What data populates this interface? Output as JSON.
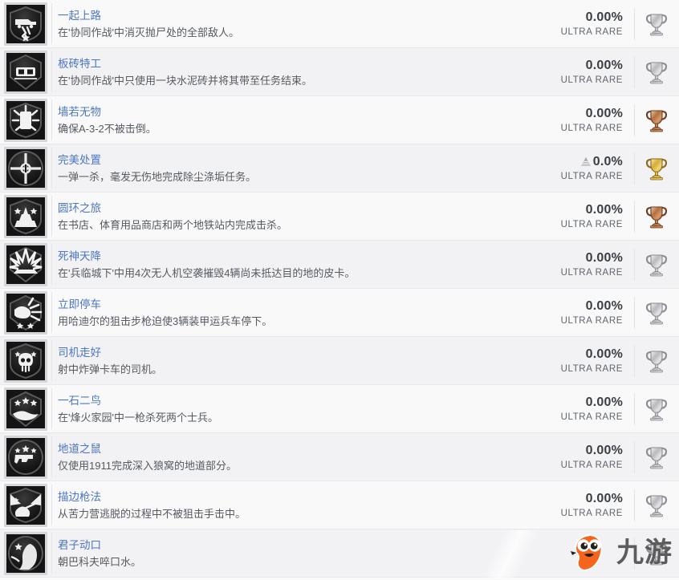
{
  "list": {
    "rarity_label_default": "ULTRA RARE",
    "rows": [
      {
        "title": "一起上路",
        "desc": "在'协同作战'中消灭抛尸处的全部敌人。",
        "percent": "0.00%",
        "rarity": "ULTRA RARE",
        "trophy": "silver-trophy-icon",
        "icon": "badge-truck-icon",
        "has_pyramid": false
      },
      {
        "title": "板砖特工",
        "desc": "在'协同作战'中只使用一块水泥砖并将其带至任务结束。",
        "percent": "0.00%",
        "rarity": "ULTRA RARE",
        "trophy": "silver-trophy-icon",
        "icon": "badge-brick-icon",
        "has_pyramid": false
      },
      {
        "title": "墙若无物",
        "desc": "确保A-3-2不被击倒。",
        "percent": "0.00%",
        "rarity": "ULTRA RARE",
        "trophy": "bronze-trophy-icon",
        "icon": "badge-wall-icon",
        "has_pyramid": false
      },
      {
        "title": "完美处置",
        "desc": "一弹一杀，毫发无伤地完成除尘涤垢任务。",
        "percent": "0.0%",
        "rarity": "ULTRA RARE",
        "trophy": "gold-trophy-icon",
        "icon": "badge-crosshair-icon",
        "has_pyramid": true
      },
      {
        "title": "圆环之旅",
        "desc": "在书店、体育用品商店和两个地铁站内完成击杀。",
        "percent": "0.00%",
        "rarity": "ULTRA RARE",
        "trophy": "bronze-trophy-icon",
        "icon": "badge-tower-icon",
        "has_pyramid": false
      },
      {
        "title": "死神天降",
        "desc": "在'兵临城下'中用4次无人机空袭摧毁4辆尚未抵达目的地的皮卡。",
        "percent": "0.00%",
        "rarity": "ULTRA RARE",
        "trophy": "silver-trophy-icon",
        "icon": "badge-drone-icon",
        "has_pyramid": false
      },
      {
        "title": "立即停车",
        "desc": "用哈迪尔的狙击步枪迫使3辆装甲运兵车停下。",
        "percent": "0.00%",
        "rarity": "ULTRA RARE",
        "trophy": "silver-trophy-icon",
        "icon": "badge-impact-icon",
        "has_pyramid": false
      },
      {
        "title": "司机走好",
        "desc": "射中炸弹卡车的司机。",
        "percent": "0.00%",
        "rarity": "ULTRA RARE",
        "trophy": "silver-trophy-icon",
        "icon": "badge-skull-icon",
        "has_pyramid": false
      },
      {
        "title": "一石二鸟",
        "desc": "在'烽火家园'中一枪杀死两个士兵。",
        "percent": "0.00%",
        "rarity": "ULTRA RARE",
        "trophy": "silver-trophy-icon",
        "icon": "badge-stars-icon",
        "has_pyramid": false
      },
      {
        "title": "地道之鼠",
        "desc": "仅使用1911完成深入狼窝的地道部分。",
        "percent": "0.00%",
        "rarity": "ULTRA RARE",
        "trophy": "silver-trophy-icon",
        "icon": "badge-pistol-icon",
        "has_pyramid": false
      },
      {
        "title": "描边枪法",
        "desc": "从苦力营逃脱的过程中不被狙击手击中。",
        "percent": "0.00%",
        "rarity": "ULTRA RARE",
        "trophy": "silver-trophy-icon",
        "icon": "badge-sniper-icon",
        "has_pyramid": false
      },
      {
        "title": "君子动口",
        "desc": "朝巴科夫啐口水。",
        "percent": "",
        "rarity": "",
        "trophy": "silver-trophy-icon",
        "icon": "badge-profile-icon",
        "has_pyramid": false
      }
    ]
  },
  "watermark": {
    "text": "九游",
    "mascot": "jiuyou-mascot-icon"
  }
}
